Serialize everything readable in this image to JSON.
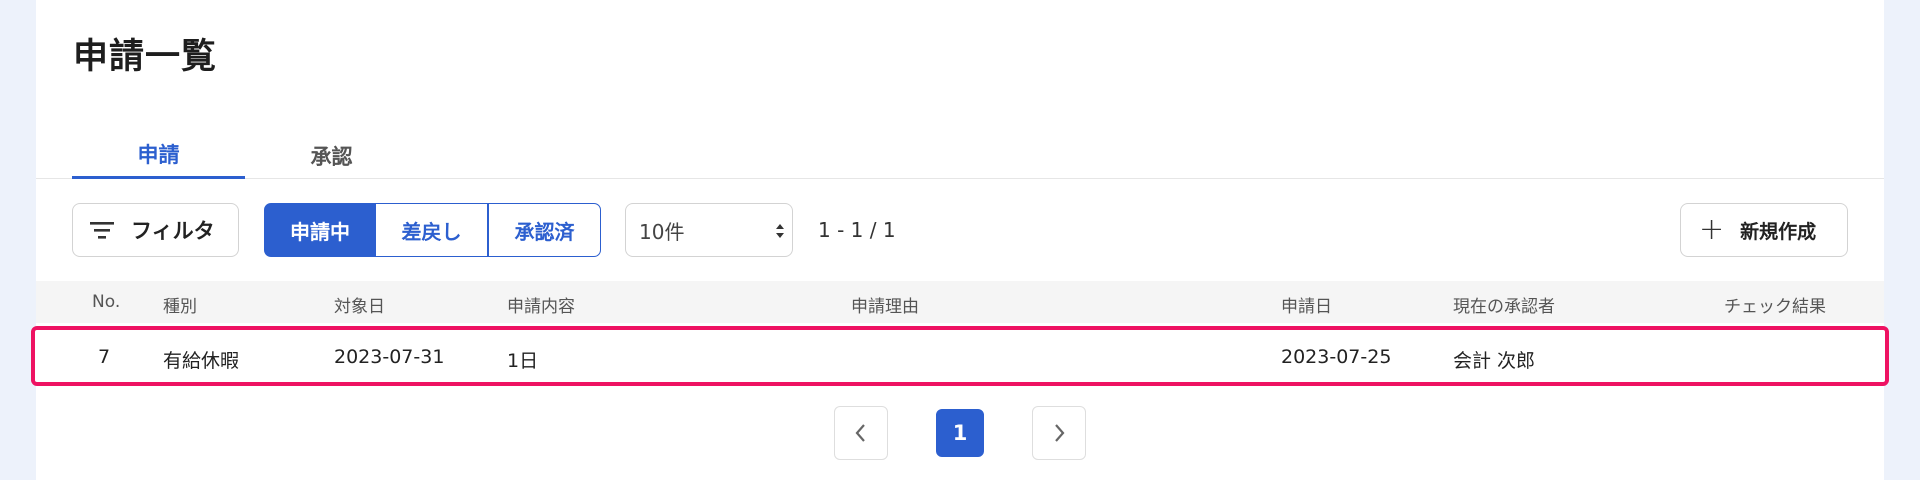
{
  "page": {
    "title": "申請一覧"
  },
  "tabs": [
    {
      "label": "申請",
      "active": true
    },
    {
      "label": "承認",
      "active": false
    }
  ],
  "toolbar": {
    "filter_label": "フィルタ",
    "filter_icon": "filter-icon",
    "status_segments": [
      {
        "label": "申請中",
        "selected": true
      },
      {
        "label": "差戻し",
        "selected": false
      },
      {
        "label": "承認済",
        "selected": false
      }
    ],
    "page_size": "10件",
    "range_text": "1 - 1 / 1",
    "new_label": "新規作成",
    "new_icon": "plus-icon"
  },
  "table": {
    "headers": [
      "No.",
      "種別",
      "対象日",
      "申請内容",
      "申請理由",
      "申請日",
      "現在の承認者",
      "チェック結果"
    ],
    "rows": [
      {
        "no": "7",
        "type": "有給休暇",
        "target_date": "2023-07-31",
        "content": "1日",
        "reason": "",
        "applied_date": "2023-07-25",
        "approver": "会計 次郎",
        "check_result": ""
      }
    ]
  },
  "pagination": {
    "current_page": "1",
    "prev_icon": "chevron-left-icon",
    "next_icon": "chevron-right-icon"
  },
  "colors": {
    "accent": "#2c5fcf",
    "highlight_border": "#ee1262",
    "page_background": "#edf2fb"
  }
}
